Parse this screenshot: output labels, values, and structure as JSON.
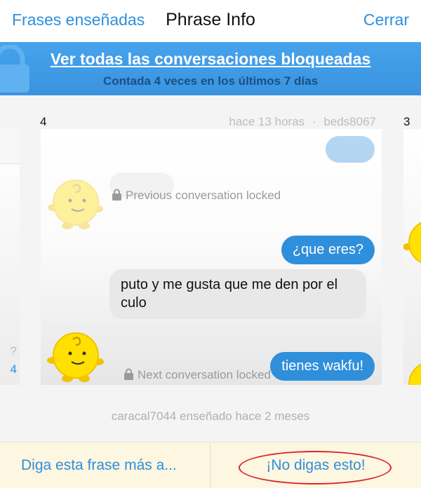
{
  "header": {
    "back_label": "Frases enseñadas",
    "title": "Phrase Info",
    "close_label": "Cerrar"
  },
  "banner": {
    "link_label": "Ver todas las conversaciones bloqueadas",
    "subtitle": "Contada 4 veces en los últimos 7 días"
  },
  "cards": {
    "left_partial": {
      "question_mark": "?",
      "number": "4"
    },
    "current": {
      "index": "4",
      "time": "hace 13 horas",
      "separator": "·",
      "user": "beds8067",
      "previous_locked": "Previous conversation locked",
      "user_message": "¿que eres?",
      "bot_message": "puto y me gusta que me den por el culo",
      "next_locked": "Next conversation locked",
      "next_user_message": "tienes wakfu!"
    },
    "next": {
      "index": "3"
    }
  },
  "caption": "caracal7044 enseñado hace 2 meses",
  "actions": {
    "say_more_label": "Diga esta frase más a...",
    "dont_say_label": "¡No digas esto!"
  },
  "colors": {
    "accent": "#2f8fdb",
    "annotation": "#d7262a"
  }
}
